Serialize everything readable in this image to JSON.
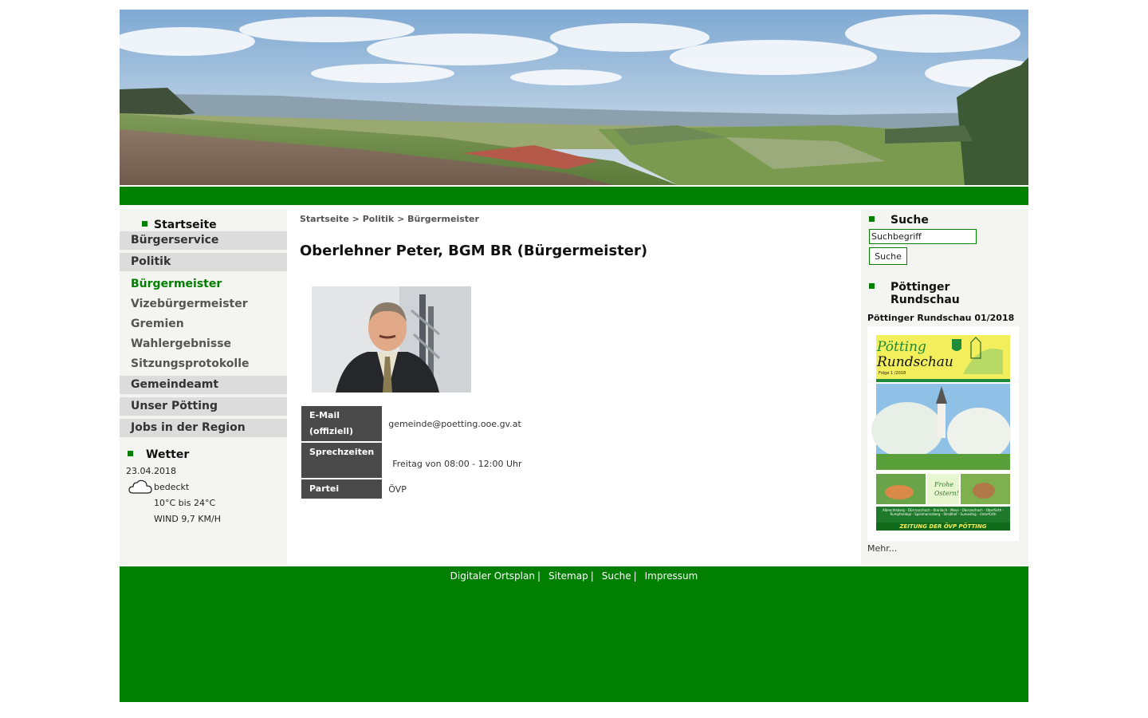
{
  "nav": {
    "home": "Startseite",
    "main_items": [
      "Bürgerservice",
      "Politik",
      "Gemeindeamt",
      "Unser Pötting",
      "Jobs in der Region"
    ],
    "sub_items": [
      "Bürgermeister",
      "Vizebürgermeister",
      "Gremien",
      "Wahlergebnisse",
      "Sitzungsprotokolle"
    ]
  },
  "weather": {
    "title": "Wetter",
    "date": "23.04.2018",
    "condition": "bedeckt",
    "temp_range": "10°C bis 24°C",
    "wind": "WIND 9,7 KM/H",
    "icon": "cloud-icon"
  },
  "breadcrumb": [
    "Startseite",
    "Politik",
    "Bürgermeister"
  ],
  "breadcrumb_sep": ">",
  "page_title": "Oberlehner Peter, BGM BR (Bürgermeister)",
  "details": [
    {
      "label": "E-Mail (offiziell)",
      "value": "gemeinde@poetting.ooe.gv.at"
    },
    {
      "label": "Sprechzeiten",
      "value": "Freitag von 08:00 - 12:00 Uhr"
    },
    {
      "label": "Partei",
      "value": "ÖVP"
    }
  ],
  "search": {
    "title": "Suche",
    "placeholder": "Suchbegriff",
    "button": "Suche"
  },
  "rundschau": {
    "title": "Pöttinger Rundschau",
    "issue": "Pöttinger Rundschau 01/2018",
    "cover_title_1": "Pötting",
    "cover_title_2": "Rundschau",
    "cover_folge": "Folge 1 /2018",
    "cover_greeting_1": "Frohe",
    "cover_greeting_2": "Ostern!",
    "cover_villages": "Albrechtsberg - Dürrnaschach - Kronlach - Moos - Oberaschach - Oberfürth - Rumpfendopl - Spielmannsberg - Straßhof - Sumeding - Unterfürth",
    "cover_footer": "ZEITUNG DER ÖVP PÖTTING",
    "more": "Mehr..."
  },
  "footer": {
    "links": [
      "Digitaler Ortsplan",
      "Sitemap",
      "Suche",
      "Impressum"
    ],
    "separator": "|"
  },
  "colors": {
    "brand_green": "#007f00",
    "nav_bg": "#dcdcdc",
    "side_bg": "#f4f4f0",
    "label_bg": "#4a4a4a"
  }
}
